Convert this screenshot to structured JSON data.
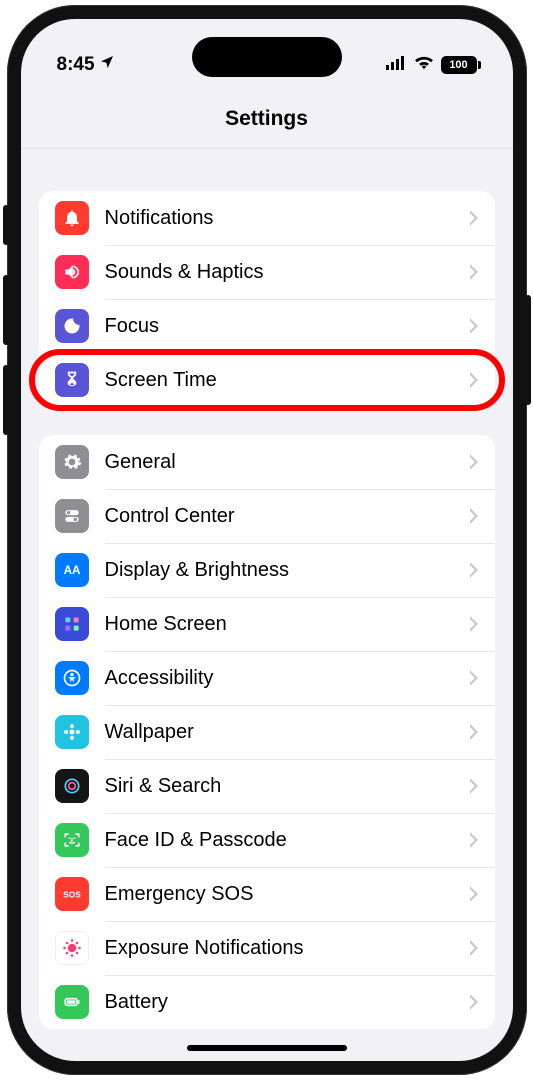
{
  "status": {
    "time": "8:45",
    "location_icon": "location-arrow",
    "signal_icon": "cell-signal",
    "wifi_icon": "wifi",
    "battery_level": "100"
  },
  "header": {
    "title": "Settings"
  },
  "groups": [
    {
      "rows": [
        {
          "id": "notifications",
          "label": "Notifications",
          "icon": "bell",
          "color": "#ff3b30"
        },
        {
          "id": "sounds",
          "label": "Sounds & Haptics",
          "icon": "speaker",
          "color": "#ff2d55"
        },
        {
          "id": "focus",
          "label": "Focus",
          "icon": "moon",
          "color": "#5856d6"
        },
        {
          "id": "screentime",
          "label": "Screen Time",
          "icon": "hourglass",
          "color": "#5856d6",
          "highlighted": true
        }
      ]
    },
    {
      "rows": [
        {
          "id": "general",
          "label": "General",
          "icon": "gear",
          "color": "#8e8e93"
        },
        {
          "id": "controlcenter",
          "label": "Control Center",
          "icon": "switches",
          "color": "#8e8e93"
        },
        {
          "id": "display",
          "label": "Display & Brightness",
          "icon": "text-aa",
          "color": "#007aff"
        },
        {
          "id": "homescreen",
          "label": "Home Screen",
          "icon": "grid",
          "color": "#3a4bd8"
        },
        {
          "id": "accessibility",
          "label": "Accessibility",
          "icon": "person-circle",
          "color": "#007aff"
        },
        {
          "id": "wallpaper",
          "label": "Wallpaper",
          "icon": "flower",
          "color": "#20c4e0"
        },
        {
          "id": "siri",
          "label": "Siri & Search",
          "icon": "siri",
          "color": "#151515"
        },
        {
          "id": "faceid",
          "label": "Face ID & Passcode",
          "icon": "face",
          "color": "#34c759"
        },
        {
          "id": "sos",
          "label": "Emergency SOS",
          "icon": "sos",
          "color": "#ff3b30"
        },
        {
          "id": "exposure",
          "label": "Exposure Notifications",
          "icon": "virus",
          "color": "#ffffff"
        },
        {
          "id": "battery",
          "label": "Battery",
          "icon": "battery",
          "color": "#34c759"
        }
      ]
    }
  ]
}
